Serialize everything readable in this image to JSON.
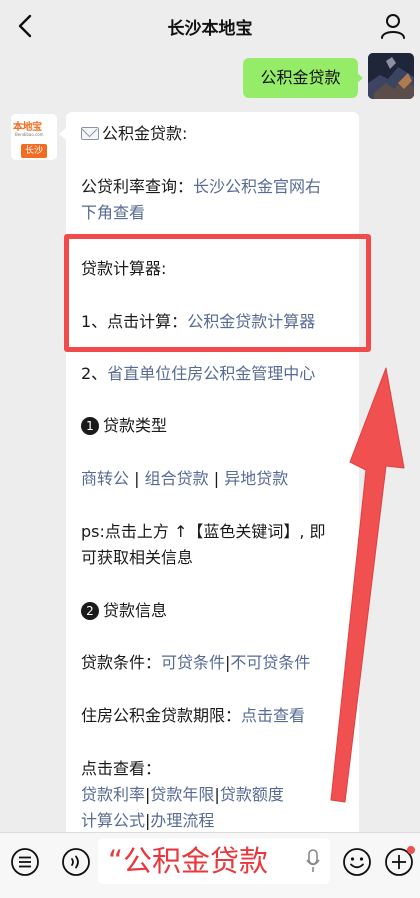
{
  "header": {
    "title": "长沙本地宝"
  },
  "sent": {
    "text": "公积金贷款"
  },
  "bot": {
    "logo_text": "本地宝",
    "logo_sub": "Bendibao.com",
    "logo_badge": "长沙"
  },
  "message": {
    "title": "公积金贷款:",
    "rate_query_label": "公贷利率查询：",
    "rate_query_link_1": "长沙公积金官网右",
    "rate_query_link_2": "下角查看",
    "calculator_label": "贷款计算器:",
    "step1_label": "1、点击计算：",
    "step1_link": "公积金贷款计算器",
    "step2_prefix": "2、",
    "step2_link": "省直单位住房公积金管理中心",
    "section1_num": "1",
    "section1_title": "贷款类型",
    "type_links": [
      "商转公",
      "组合贷款",
      "异地贷款"
    ],
    "separator": "|",
    "ps_line1": "ps:点击上方 ↑【蓝色关键词】, 即",
    "ps_line2": "可获取相关信息",
    "section2_num": "2",
    "section2_title": "贷款信息",
    "conditions_label": "贷款条件：",
    "conditions_links": [
      "可贷条件",
      "不可贷条件"
    ],
    "term_label": "住房公积金贷款期限：",
    "term_link": "点击查看",
    "click_view_label": "点击查看：",
    "info_links_row1": [
      "贷款利率",
      "贷款年限",
      "贷款额度"
    ],
    "info_links_row2": [
      "计算公式",
      "办理流程"
    ]
  },
  "input": {
    "overlay_text": "“公积金贷款"
  },
  "colors": {
    "link": "#576b95",
    "sent_bubble": "#95ec69",
    "highlight": "#f04a4a",
    "brand": "#f26d21"
  },
  "icons": {
    "back": "chevron-left-icon",
    "profile": "person-icon",
    "voice_list": "list-icon",
    "voice": "voice-icon",
    "mic": "mic-icon",
    "emoji": "emoji-icon",
    "add": "plus-icon"
  }
}
